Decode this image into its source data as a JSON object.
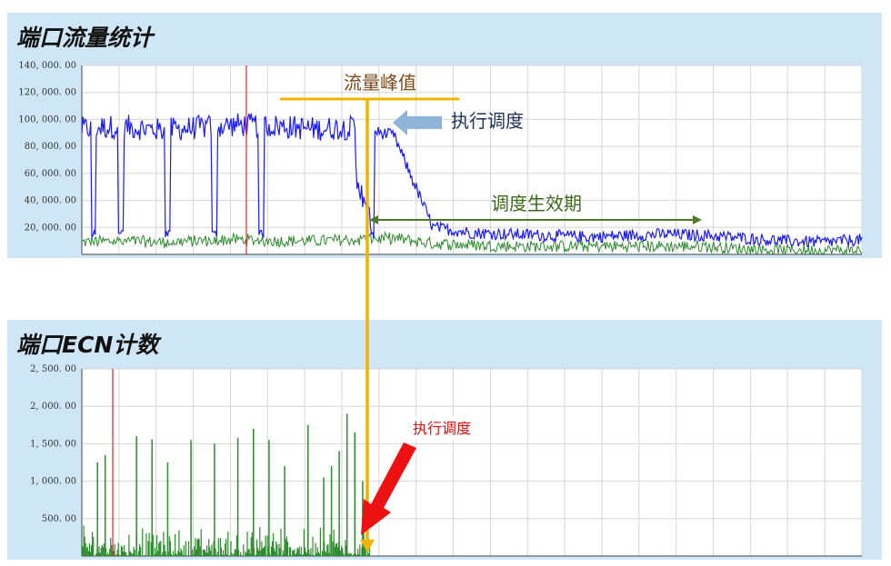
{
  "colors": {
    "panel_bg": "#cfe6f6",
    "series_traffic": "#1a1aff",
    "series_green": "#2e8b2e",
    "red_marker": "#e8202a",
    "peak_line": "#f0b400",
    "effective_arrow": "#4b7a2a",
    "blue_arrow": "#8fb4d9",
    "red_arrow": "#ee1111"
  },
  "panels": {
    "traffic": {
      "title": "端口流量统计"
    },
    "ecn": {
      "title": "端口ECN计数"
    }
  },
  "annotations": {
    "peak": "流量峰值",
    "schedule_top": "执行调度",
    "effective": "调度生效期",
    "schedule_bottom": "执行调度"
  },
  "chart_data": [
    {
      "type": "line",
      "title": "端口流量统计",
      "yticks": [
        "140, 000. 00",
        "120, 000. 00",
        "100, 000. 00",
        "80, 000. 00",
        "60, 000. 00",
        "40, 000. 00",
        "20, 000. 00"
      ],
      "ylim": [
        0,
        140000
      ],
      "grid": true,
      "x": [
        0,
        5,
        10,
        15,
        20,
        25,
        30,
        35,
        40,
        45,
        50,
        55,
        60,
        65,
        70,
        75,
        80,
        85,
        90,
        95,
        100
      ],
      "series": [
        {
          "values": [
            93000,
            95000,
            92000,
            94000,
            96000,
            95000,
            93000,
            94000,
            88000,
            20000,
            16000,
            15000,
            14000,
            13000,
            14000,
            15000,
            14000,
            12000,
            10000,
            9000,
            11000
          ]
        },
        {
          "values": [
            9000,
            10000,
            9000,
            10000,
            11000,
            10000,
            10000,
            11000,
            12000,
            8000,
            7000,
            6000,
            6000,
            6000,
            6000,
            6000,
            6000,
            4000,
            3000,
            3000,
            3000
          ]
        }
      ],
      "dips_at": [
        1.5,
        5,
        11,
        17,
        23
      ],
      "schedule_at": 37
    },
    {
      "type": "bar",
      "title": "端口ECN计数",
      "yticks": [
        "2, 500. 00",
        "2, 000. 00",
        "1, 500. 00",
        "1, 000. 00",
        "500. 00"
      ],
      "ylim": [
        0,
        2500
      ],
      "grid": true,
      "peaks": [
        {
          "x": 2,
          "v": 1250
        },
        {
          "x": 3,
          "v": 1350
        },
        {
          "x": 7,
          "v": 1600
        },
        {
          "x": 9,
          "v": 1560
        },
        {
          "x": 11,
          "v": 1250
        },
        {
          "x": 14,
          "v": 1550
        },
        {
          "x": 17,
          "v": 1500
        },
        {
          "x": 20,
          "v": 1580
        },
        {
          "x": 22,
          "v": 1700
        },
        {
          "x": 24,
          "v": 1550
        },
        {
          "x": 26,
          "v": 1200
        },
        {
          "x": 29,
          "v": 1750
        },
        {
          "x": 31,
          "v": 1050
        },
        {
          "x": 32,
          "v": 1200
        },
        {
          "x": 33,
          "v": 1400
        },
        {
          "x": 34,
          "v": 1900
        },
        {
          "x": 35,
          "v": 1650
        },
        {
          "x": 36,
          "v": 1000
        }
      ],
      "schedule_at": 37
    }
  ]
}
